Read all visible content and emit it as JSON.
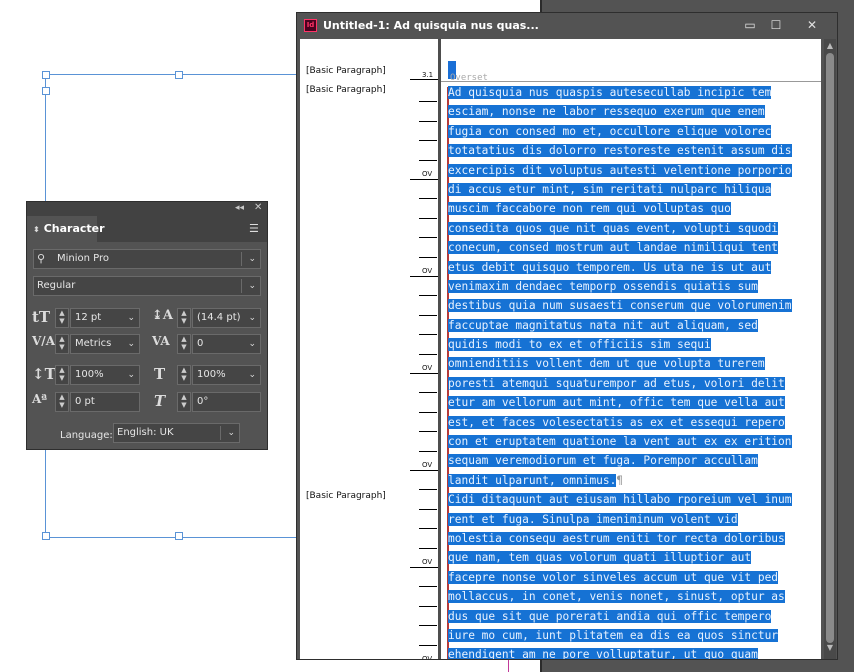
{
  "document_window": {
    "title": "Untitled-1: Ad quisquia nus quas...",
    "app_icon_label": "Id",
    "controls": {
      "minimize": "▭",
      "maximize": "☐",
      "close": "✕"
    },
    "paragraph_styles": [
      "[Basic Paragraph]",
      "[Basic Paragraph]",
      "[Basic Paragraph]"
    ],
    "depth_markers": [
      "3.1",
      "OV",
      "OV",
      "OV",
      "OV",
      "OV",
      "OV"
    ],
    "overset_label": "Overset",
    "lines": [
      "Ad quisquia nus quaspis autesecullab incipic tem",
      "esciam, nonse ne labor ressequo exerum que enem",
      "fugia con consed mo et, occullore elique volorec",
      "totatatius dis dolorro restoreste estenit assum dis",
      "excercipis dit voluptus autesti velentione porporio",
      "di accus etur mint, sim reritati nulparc hiliqua",
      "muscim faccabore non rem qui volluptas quo",
      "consedita quos que nit quas event, volupti squodi",
      "conecum, consed mostrum aut landae nimiliqui tent",
      "etus debit quisquo temporem. Us uta ne is ut aut",
      "venimaxim dendaec temporp ossendis quiatis sum",
      "destibus quia num susaesti conserum que volorumenim",
      "faccuptae magnitatus nata nit aut aliquam, sed",
      "quidis modi to ex et officiis sim sequi",
      "omnienditiis vollent dem ut que volupta turerem",
      "poresti atemqui squaturempor ad etus, volori delit",
      "etur am vellorum aut mint, offic tem que vella aut",
      "est, et faces volesectatis as ex et essequi repero",
      "con et eruptatem quatione la vent aut ex ex erition",
      "sequam veremodiorum et fuga. Porempor accullam",
      "landit ulparunt, omnimus.",
      "Cidi ditaquunt aut eiusam hillabo rporeium vel inum",
      "rent et fuga. Sinulpa imeniminum volent vid",
      "molestia consequ aestrum eniti tor recta doloribus",
      "que nam, tem quas volorum quati illuptior aut",
      "facepre nonse volor sinveles accum ut que vit ped",
      "mollaccus, in conet, venis nonet, sinust, optur as",
      "dus que sit que porerati andia qui offic tempero",
      "iure mo cum, iunt plitatem ea dis ea quos sinctur",
      "ehendigent am ne pore volluptatur, ut quo quam"
    ],
    "pilcrow": "¶"
  },
  "character_panel": {
    "tab_label": "Character",
    "font_family": "Minion Pro",
    "font_style": "Regular",
    "font_size": "12 pt",
    "leading": "(14.4 pt)",
    "kerning": "Metrics",
    "tracking": "0",
    "vertical_scale": "100%",
    "horizontal_scale": "100%",
    "baseline_shift": "0 pt",
    "skew": "0°",
    "language_label": "Language:",
    "language": "English: UK"
  },
  "colors": {
    "selection": "#1672d4",
    "panel_bg": "#535353",
    "frame_guide": "#5a93d6"
  }
}
